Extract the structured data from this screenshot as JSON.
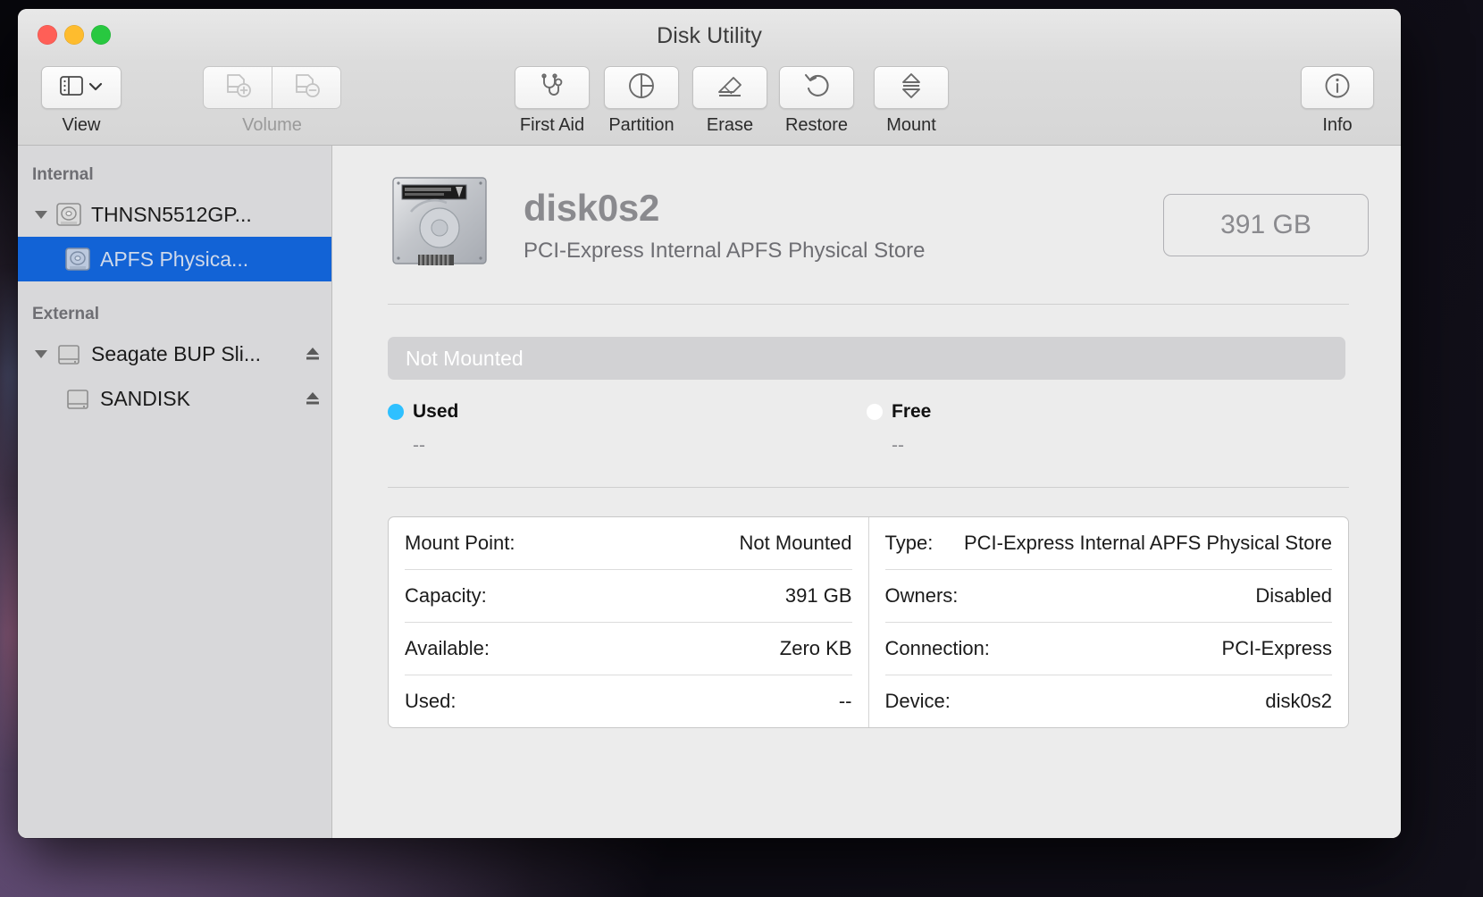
{
  "window": {
    "title": "Disk Utility"
  },
  "traffic": {
    "close": "close-button",
    "minimize": "minimize-button",
    "zoom": "zoom-button"
  },
  "toolbar": {
    "view_label": "View",
    "volume_label": "Volume",
    "actions": [
      {
        "label": "First Aid",
        "icon": "stethoscope-icon"
      },
      {
        "label": "Partition",
        "icon": "pie-chart-icon"
      },
      {
        "label": "Erase",
        "icon": "eraser-icon"
      },
      {
        "label": "Restore",
        "icon": "undo-arrow-icon"
      },
      {
        "label": "Mount",
        "icon": "eject-icon"
      }
    ],
    "info_label": "Info"
  },
  "sidebar": {
    "sections": [
      {
        "header": "Internal",
        "items": [
          {
            "name": "THNSN5512GP...",
            "icon": "internal-drive-icon",
            "indent": false,
            "twisty": true,
            "selected": false,
            "eject": false
          },
          {
            "name": "APFS Physica...",
            "icon": "internal-drive-icon",
            "indent": true,
            "twisty": false,
            "selected": true,
            "eject": false
          }
        ]
      },
      {
        "header": "External",
        "items": [
          {
            "name": "Seagate BUP Sli...",
            "icon": "external-drive-icon",
            "indent": false,
            "twisty": true,
            "selected": false,
            "eject": true
          },
          {
            "name": "SANDISK",
            "icon": "external-drive-icon",
            "indent": true,
            "twisty": false,
            "selected": false,
            "eject": true
          }
        ]
      }
    ]
  },
  "detail": {
    "disk_name": "disk0s2",
    "disk_subtitle": "PCI-Express Internal APFS Physical Store",
    "capacity_badge": "391 GB",
    "storage_bar_label": "Not Mounted",
    "legend": [
      {
        "label": "Used",
        "value": "--",
        "color": "#2ec0ff"
      },
      {
        "label": "Free",
        "value": "--",
        "color": "#ffffff"
      }
    ],
    "table_left": [
      {
        "key": "Mount Point:",
        "value": "Not Mounted"
      },
      {
        "key": "Capacity:",
        "value": "391 GB"
      },
      {
        "key": "Available:",
        "value": "Zero KB"
      },
      {
        "key": "Used:",
        "value": "--"
      }
    ],
    "table_right": [
      {
        "key": "Type:",
        "value": "PCI-Express Internal APFS Physical Store"
      },
      {
        "key": "Owners:",
        "value": "Disabled"
      },
      {
        "key": "Connection:",
        "value": "PCI-Express"
      },
      {
        "key": "Device:",
        "value": "disk0s2"
      }
    ]
  },
  "colors": {
    "selection_blue": "#1263d6",
    "used_blue": "#2ec0ff",
    "sidebar_bg": "#d8d8da",
    "pane_bg": "#ececec"
  }
}
